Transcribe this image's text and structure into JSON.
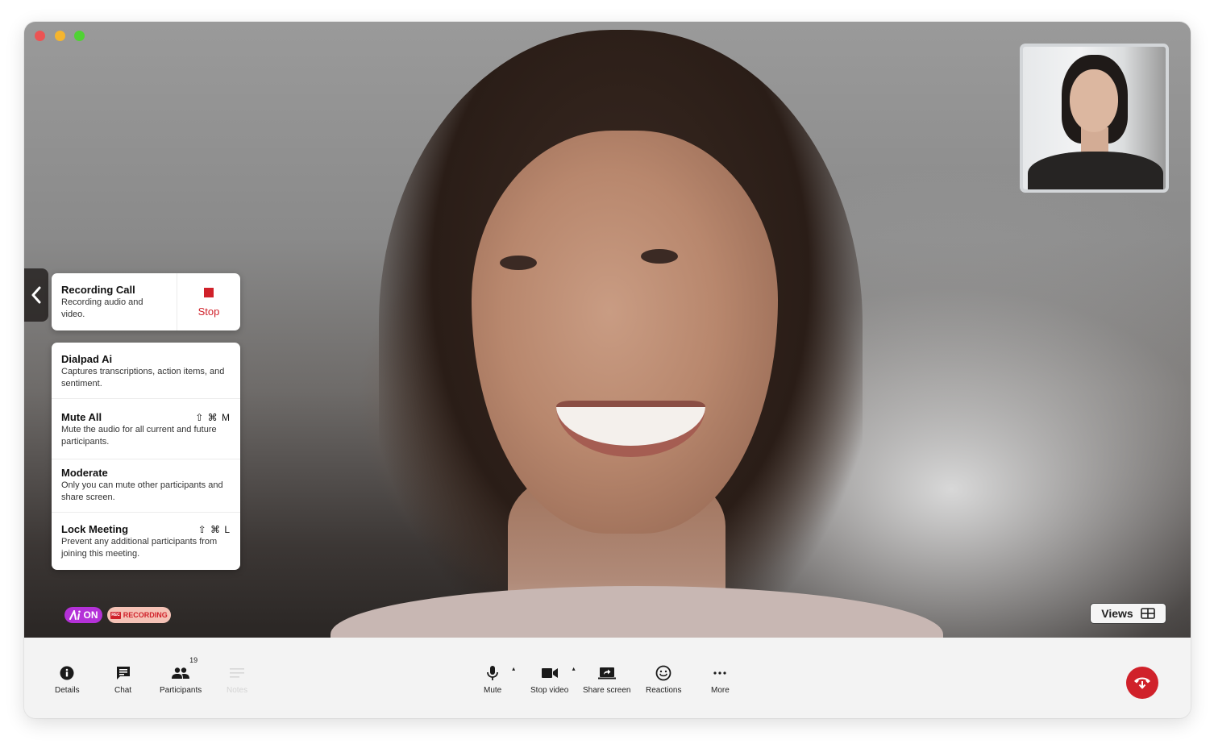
{
  "window": {
    "traffic_lights": [
      "close",
      "minimize",
      "zoom"
    ]
  },
  "video": {
    "main_participant": "smiling woman with long dark curly hair",
    "self_view": "smiling woman with short dark hair"
  },
  "recording_card": {
    "title": "Recording Call",
    "description": "Recording audio and video.",
    "stop_label": "Stop",
    "accent": "#d0212a"
  },
  "menu": {
    "items": [
      {
        "title": "Dialpad Ai",
        "description": "Captures transcriptions, action items, and sentiment.",
        "shortcut": ""
      },
      {
        "title": "Mute All",
        "description": "Mute the audio for all current and future participants.",
        "shortcut": "⇧ ⌘ M"
      },
      {
        "title": "Moderate",
        "description": "Only you can mute other participants and share screen.",
        "shortcut": ""
      },
      {
        "title": "Lock Meeting",
        "description": "Prevent any additional participants from joining this meeting.",
        "shortcut": "⇧ ⌘ L"
      }
    ]
  },
  "badges": {
    "ai_label": "ON",
    "ai_color": "#b431d8",
    "rec_icon_text": "REC",
    "rec_label": "RECORDING",
    "rec_color": "#d0212a"
  },
  "views_button": {
    "label": "Views"
  },
  "toolbar": {
    "left": [
      {
        "label": "Details",
        "icon": "info-icon"
      },
      {
        "label": "Chat",
        "icon": "chat-icon"
      },
      {
        "label": "Participants",
        "icon": "people-icon",
        "count": "19"
      },
      {
        "label": "Notes",
        "icon": "notes-icon",
        "disabled": true
      }
    ],
    "center": [
      {
        "label": "Mute",
        "icon": "microphone-icon"
      },
      {
        "label": "Stop video",
        "icon": "video-camera-icon"
      },
      {
        "label": "Share screen",
        "icon": "share-screen-icon"
      },
      {
        "label": "Reactions",
        "icon": "smiley-icon"
      },
      {
        "label": "More",
        "icon": "more-dots-icon"
      }
    ],
    "hangup_color": "#d0212a"
  }
}
